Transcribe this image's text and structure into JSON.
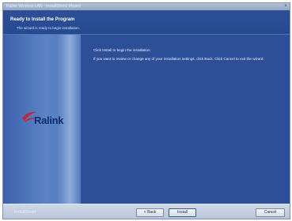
{
  "window": {
    "title": "Ralink Wireless LAN - InstallShield Wizard",
    "close_glyph": "×"
  },
  "header": {
    "title": "Ready to Install the Program",
    "subtitle": "The wizard is ready to begin installation."
  },
  "left_panel": {
    "logo_text": "Ralink"
  },
  "content": {
    "line1": "Click Install to begin the installation.",
    "line2": "If you want to review or change any of your installation settings, click Back. Click Cancel to exit the wizard."
  },
  "footer": {
    "brand": "InstallShield",
    "back_label": "< Back",
    "install_label": "Install",
    "cancel_label": "Cancel"
  },
  "colors": {
    "window_bg": "#2c4f97",
    "logo_swoosh": "#c8232c",
    "logo_text": "#0d2d6f"
  },
  "icons": [
    "close-icon",
    "ralink-logo"
  ]
}
